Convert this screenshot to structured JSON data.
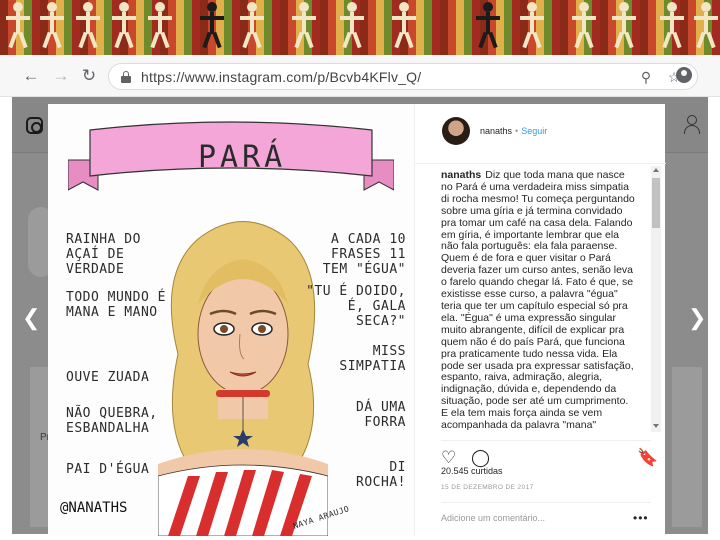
{
  "browser": {
    "url": "https://www.instagram.com/p/Bcvb4KFlv_Q/",
    "icons": {
      "back": "arrow-left-icon",
      "forward": "arrow-right-icon",
      "reload": "reload-icon",
      "lock": "lock-icon",
      "zoom": "zoom-icon",
      "bookmark": "star-icon",
      "profile": "account-icon"
    }
  },
  "background_page": {
    "side_label": "Prin"
  },
  "post": {
    "illustration": {
      "title": "PARÁ",
      "left_phrases": [
        "RAINHA DO AÇAÍ DE VERDADE",
        "TODO MUNDO É MANA E MANO",
        "OUVE ZUADA",
        "NÃO QUEBRA, ESBANDALHA",
        "PAI D'ÉGUA"
      ],
      "right_phrases": [
        "A CADA 10 FRASES 11 TEM \"ÉGUA\"",
        "\"TU É DOIDO, É, GALA SECA?\"",
        "MISS SIMPATIA",
        "DÁ UMA FORRA",
        "DI ROCHA!"
      ],
      "signature": "@NANATHS",
      "artist": "NAYA ARAUJO",
      "colors": {
        "ribbon": "#f4a6d8",
        "hair": "#e8c873",
        "choker": "#d23a2e",
        "stripe": "#d82e2e"
      }
    },
    "owner": "nanaths",
    "separator": "•",
    "follow_label": "Seguir",
    "caption_user": "nanaths",
    "caption_text": "Diz que toda mana que nasce no Pará é uma verdadeira miss simpatia di rocha mesmo! Tu começa perguntando sobre uma gíria e já termina convidado pra tomar um café na casa dela. Falando em gíria, é importante lembrar que ela não fala português: ela fala paraense. Quem é de fora e quer visitar o Pará deveria fazer um curso antes, senão leva o farelo quando chegar lá. Fato é que, se existisse esse curso, a palavra \"égua\" teria que ter um capítulo especial só pra ela. \"Égua\" é uma expressão singular muito abrangente, difícil de explicar pra quem não é do país Pará, que funciona pra praticamente tudo nessa vida. Ela pode ser usada pra expressar satisfação, espanto, raiva, admiração, alegria, indignação, dúvida e, dependendo da situação, pode ser até um cumprimento. E ela tem mais força ainda se vem acompanhada da palavra \"mana\"",
    "likes": "20.545 curtidas",
    "date": "15 DE DEZEMBRO DE 2017",
    "comment_placeholder": "Adicione um comentário...",
    "more_label": "•••",
    "icons": {
      "like": "heart-icon",
      "comment": "comment-icon",
      "save": "bookmark-icon"
    }
  }
}
